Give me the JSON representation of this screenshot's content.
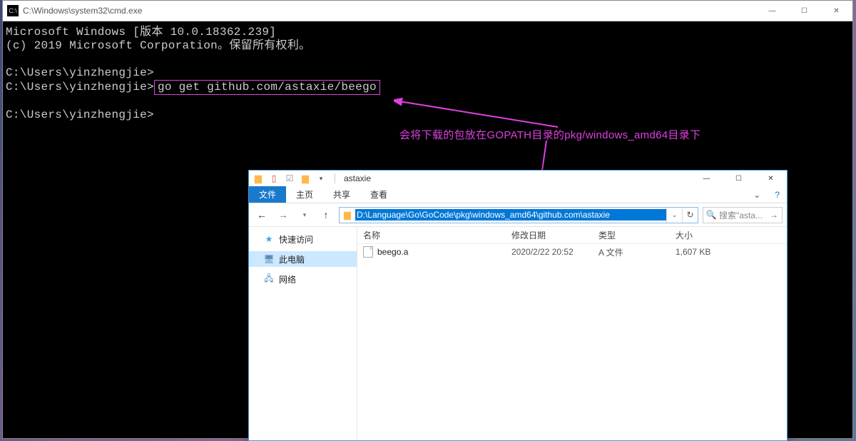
{
  "cmd": {
    "title": "C:\\Windows\\system32\\cmd.exe",
    "line1": "Microsoft Windows [版本 10.0.18362.239]",
    "line2": "(c) 2019 Microsoft Corporation。保留所有权利。",
    "prompt1": "C:\\Users\\yinzhengjie>",
    "prompt2": "C:\\Users\\yinzhengjie>",
    "command": "go get github.com/astaxie/beego",
    "prompt3": "C:\\Users\\yinzhengjie>"
  },
  "annotation": {
    "text": "会将下载的包放在GOPATH目录的pkg/windows_amd64目录下"
  },
  "explorer": {
    "titlebar_name": "astaxie",
    "ribbon": {
      "file": "文件",
      "home": "主页",
      "share": "共享",
      "view": "查看"
    },
    "address": "D:\\Language\\Go\\GoCode\\pkg\\windows_amd64\\github.com\\astaxie",
    "search_placeholder": "搜索\"asta...",
    "sidebar": {
      "quick": "快速访问",
      "pc": "此电脑",
      "network": "网络"
    },
    "columns": {
      "name": "名称",
      "date": "修改日期",
      "type": "类型",
      "size": "大小"
    },
    "files": [
      {
        "name": "beego.a",
        "date": "2020/2/22 20:52",
        "type": "A 文件",
        "size": "1,607 KB"
      }
    ]
  },
  "window_controls": {
    "min": "—",
    "max": "☐",
    "close": "✕"
  }
}
